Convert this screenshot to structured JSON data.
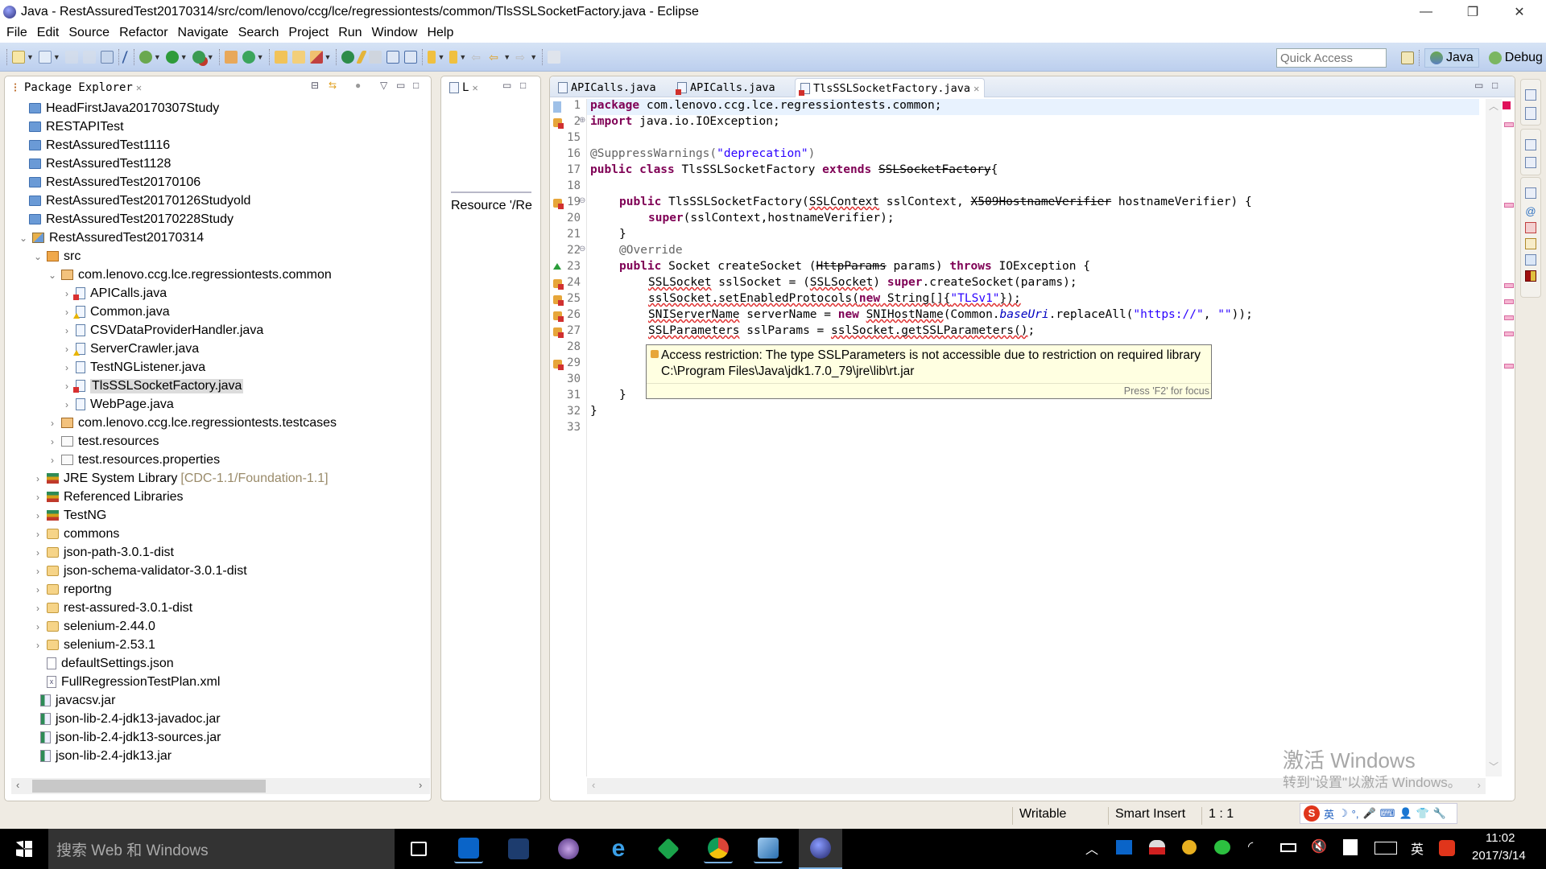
{
  "window": {
    "title": "Java - RestAssuredTest20170314/src/com/lenovo/ccg/lce/regressiontests/common/TlsSSLSocketFactory.java - Eclipse",
    "controls": {
      "minimize": "—",
      "maximize": "❐",
      "close": "✕"
    }
  },
  "menu": [
    "File",
    "Edit",
    "Source",
    "Refactor",
    "Navigate",
    "Search",
    "Project",
    "Run",
    "Window",
    "Help"
  ],
  "toolbar": {
    "quick_access_placeholder": "Quick Access",
    "perspectives": [
      {
        "label": "Java",
        "icon": "java-perspective-icon",
        "active": true
      },
      {
        "label": "Debug",
        "icon": "debug-perspective-icon",
        "active": false
      }
    ]
  },
  "package_explorer": {
    "title": "Package Explorer",
    "selected": "TlsSSLSocketFactory.java",
    "items": [
      {
        "label": "HeadFirstJava20170307Study",
        "type": "project",
        "depth": 0,
        "expand": ""
      },
      {
        "label": "RESTAPITest",
        "type": "project",
        "depth": 0,
        "expand": ""
      },
      {
        "label": "RestAssuredTest1116",
        "type": "project",
        "depth": 0,
        "expand": ""
      },
      {
        "label": "RestAssuredTest1128",
        "type": "project",
        "depth": 0,
        "expand": ""
      },
      {
        "label": "RestAssuredTest20170106",
        "type": "project",
        "depth": 0,
        "expand": ""
      },
      {
        "label": "RestAssuredTest20170126Studyold",
        "type": "project",
        "depth": 0,
        "expand": ""
      },
      {
        "label": "RestAssuredTest20170228Study",
        "type": "project",
        "depth": 0,
        "expand": ""
      },
      {
        "label": "RestAssuredTest20170314",
        "type": "project-error",
        "depth": 0,
        "expand": "open"
      },
      {
        "label": "src",
        "type": "source-folder",
        "depth": 1,
        "expand": "open"
      },
      {
        "label": "com.lenovo.ccg.lce.regressiontests.common",
        "type": "package",
        "depth": 2,
        "expand": "open"
      },
      {
        "label": "APICalls.java",
        "type": "java-error",
        "depth": 3,
        "expand": "closed"
      },
      {
        "label": "Common.java",
        "type": "java-warning",
        "depth": 3,
        "expand": "closed"
      },
      {
        "label": "CSVDataProviderHandler.java",
        "type": "java",
        "depth": 3,
        "expand": "closed"
      },
      {
        "label": "ServerCrawler.java",
        "type": "java-warning",
        "depth": 3,
        "expand": "closed"
      },
      {
        "label": "TestNGListener.java",
        "type": "java",
        "depth": 3,
        "expand": "closed"
      },
      {
        "label": "TlsSSLSocketFactory.java",
        "type": "java-error",
        "depth": 3,
        "expand": "closed"
      },
      {
        "label": "WebPage.java",
        "type": "java",
        "depth": 3,
        "expand": "closed"
      },
      {
        "label": "com.lenovo.ccg.lce.regressiontests.testcases",
        "type": "package",
        "depth": 2,
        "expand": "closed"
      },
      {
        "label": "test.resources",
        "type": "resource-package",
        "depth": 2,
        "expand": "closed"
      },
      {
        "label": "test.resources.properties",
        "type": "resource-package",
        "depth": 2,
        "expand": "closed"
      },
      {
        "label": "JRE System Library",
        "decoration": "[CDC-1.1/Foundation-1.1]",
        "type": "library",
        "depth": 1,
        "expand": "closed"
      },
      {
        "label": "Referenced Libraries",
        "type": "library",
        "depth": 1,
        "expand": "closed"
      },
      {
        "label": "TestNG",
        "type": "library",
        "depth": 1,
        "expand": "closed"
      },
      {
        "label": "commons",
        "type": "folder",
        "depth": 1,
        "expand": "closed"
      },
      {
        "label": "json-path-3.0.1-dist",
        "type": "folder",
        "depth": 1,
        "expand": "closed"
      },
      {
        "label": "json-schema-validator-3.0.1-dist",
        "type": "folder",
        "depth": 1,
        "expand": "closed"
      },
      {
        "label": "reportng",
        "type": "folder",
        "depth": 1,
        "expand": "closed"
      },
      {
        "label": "rest-assured-3.0.1-dist",
        "type": "folder",
        "depth": 1,
        "expand": "closed"
      },
      {
        "label": "selenium-2.44.0",
        "type": "folder",
        "depth": 1,
        "expand": "closed"
      },
      {
        "label": "selenium-2.53.1",
        "type": "folder",
        "depth": 1,
        "expand": "closed"
      },
      {
        "label": "defaultSettings.json",
        "type": "file",
        "depth": 1,
        "expand": ""
      },
      {
        "label": "FullRegressionTestPlan.xml",
        "type": "xml",
        "depth": 1,
        "expand": ""
      },
      {
        "label": "javacsv.jar",
        "type": "jar",
        "depth": 1,
        "expand": ""
      },
      {
        "label": "json-lib-2.4-jdk13-javadoc.jar",
        "type": "jar",
        "depth": 1,
        "expand": ""
      },
      {
        "label": "json-lib-2.4-jdk13-sources.jar",
        "type": "jar",
        "depth": 1,
        "expand": ""
      },
      {
        "label": "json-lib-2.4-jdk13.jar",
        "type": "jar",
        "depth": 1,
        "expand": ""
      }
    ]
  },
  "outline_view": {
    "title": "L",
    "content": "Resource '/Re"
  },
  "editor": {
    "tabs": [
      {
        "label": "APICalls.java",
        "error": false,
        "active": false
      },
      {
        "label": "APICalls.java",
        "error": true,
        "active": false
      },
      {
        "label": "TlsSSLSocketFactory.java",
        "error": true,
        "active": true
      }
    ],
    "lines": [
      {
        "n": "1",
        "marker": "",
        "fold": ""
      },
      {
        "n": "2",
        "marker": "error",
        "fold": "⊕"
      },
      {
        "n": "15",
        "marker": "",
        "fold": ""
      },
      {
        "n": "16",
        "marker": "",
        "fold": ""
      },
      {
        "n": "17",
        "marker": "",
        "fold": ""
      },
      {
        "n": "18",
        "marker": "",
        "fold": ""
      },
      {
        "n": "19",
        "marker": "error",
        "fold": "⊖"
      },
      {
        "n": "20",
        "marker": "",
        "fold": ""
      },
      {
        "n": "21",
        "marker": "",
        "fold": ""
      },
      {
        "n": "22",
        "marker": "",
        "fold": "⊖"
      },
      {
        "n": "23",
        "marker": "override",
        "fold": ""
      },
      {
        "n": "24",
        "marker": "error",
        "fold": ""
      },
      {
        "n": "25",
        "marker": "error",
        "fold": ""
      },
      {
        "n": "26",
        "marker": "error",
        "fold": ""
      },
      {
        "n": "27",
        "marker": "error",
        "fold": ""
      },
      {
        "n": "28",
        "marker": "",
        "fold": ""
      },
      {
        "n": "29",
        "marker": "error",
        "fold": ""
      },
      {
        "n": "30",
        "marker": "",
        "fold": ""
      },
      {
        "n": "31",
        "marker": "",
        "fold": ""
      },
      {
        "n": "32",
        "marker": "",
        "fold": ""
      },
      {
        "n": "33",
        "marker": "",
        "fold": ""
      }
    ],
    "code": {
      "l1_kw": "package",
      "l1_rest": " com.lenovo.ccg.lce.regressiontests.common;",
      "l2_kw": "import",
      "l2_rest": " java.io.IOException;",
      "l16_ann": "@SuppressWarnings(",
      "l16_str": "\"deprecation\"",
      "l16_end": ")",
      "l17_kw1": "public class",
      "l17_name": " TlsSSLSocketFactory ",
      "l17_kw2": "extends",
      "l17_sp": " ",
      "l17_dep": "SSLSocketFactory",
      "l17_end": "{",
      "l19_kw": "public",
      "l19_a": " TlsSSLSocketFactory(",
      "l19_err": "SSLContext",
      "l19_b": " sslContext, ",
      "l19_dep": "X509HostnameVerifier",
      "l19_c": " hostnameVerifier) {",
      "l20_kw": "super",
      "l20_rest": "(sslContext,hostnameVerifier);",
      "l21": "}",
      "l22_ann": "@Override",
      "l23_kw1": "public",
      "l23_a": " Socket createSocket (",
      "l23_dep": "HttpParams",
      "l23_b": " params) ",
      "l23_kw2": "throws",
      "l23_c": " IOException {",
      "l24_err1": "SSLSocket",
      "l24_a": " sslSocket = (",
      "l24_err2": "SSLSocket",
      "l24_b": ") ",
      "l24_kw": "super",
      "l24_c": ".createSocket(params);",
      "l25_err": "sslSocket.setEnabledProtocols(",
      "l25_kw": "new",
      "l25_a": " String[]{",
      "l25_str": "\"TLSv1\"",
      "l25_b": "});",
      "l26_err1": "SNIServerName",
      "l26_a": " serverName = ",
      "l26_kw": "new",
      "l26_b": " ",
      "l26_err2": "SNIHostName",
      "l26_c": "(Common.",
      "l26_it": "baseUri",
      "l26_d": ".replaceAll(",
      "l26_str1": "\"https://\"",
      "l26_e": ", ",
      "l26_str2": "\"\"",
      "l26_f": "));",
      "l27_err1": "SSLParameters",
      "l27_a": " sslParams = ",
      "l27_err2": "sslSocket.getSSLParameters()",
      "l27_b": ";",
      "l31": "}",
      "l32": "}"
    },
    "hover": {
      "message": "Access restriction: The type SSLParameters is not accessible due to restriction on required library C:\\Program Files\\Java\\jdk1.7.0_79\\jre\\lib\\rt.jar",
      "hint": "Press 'F2' for focus"
    }
  },
  "status_bar": {
    "writable": "Writable",
    "insert_mode": "Smart Insert",
    "position": "1 : 1"
  },
  "watermark": {
    "line1": "激活 Windows",
    "line2": "转到\"设置\"以激活 Windows。"
  },
  "ime_bar": [
    "S",
    "英",
    "☽",
    "°,",
    "🎤",
    "⌨",
    "👤",
    "👕",
    "🔧"
  ],
  "taskbar": {
    "search_placeholder": "搜索 Web 和 Windows",
    "apps": [
      "task-view",
      "outlook",
      "app-8",
      "eclipse-purple",
      "internet-explorer",
      "green-app",
      "chrome",
      "remote-app",
      "eclipse"
    ],
    "tray_lang": "英",
    "time": "11:02",
    "date": "2017/3/14"
  }
}
